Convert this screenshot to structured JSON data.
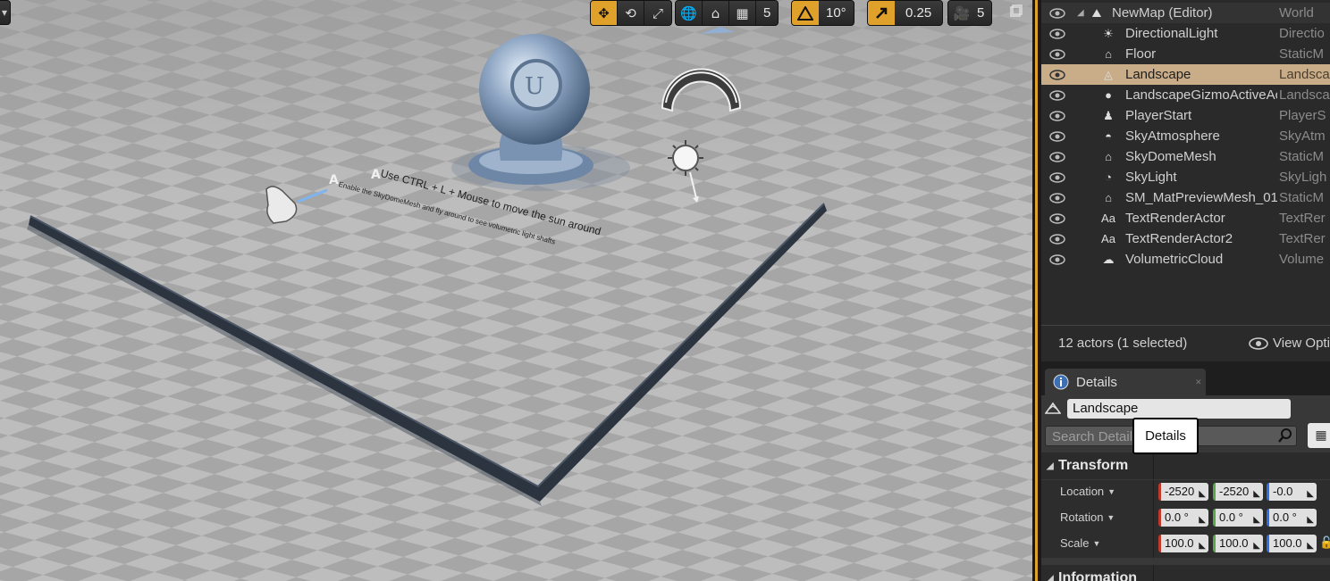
{
  "viewport": {
    "toolbar": {
      "grid_snap_value": "5",
      "rotation_snap_value": "10°",
      "scale_snap_value": "0.25",
      "camera_speed_value": "5"
    },
    "text_actor_1": "Use CTRL + L + Mouse to move the sun around",
    "text_actor_2": "Enable the SkyDomeMesh and fly around to see volumetric light shafts"
  },
  "outliner": {
    "rows": [
      {
        "name": "NewMap (Editor)",
        "type": "World",
        "icon": "map-icon"
      },
      {
        "name": "DirectionalLight",
        "type": "Directio",
        "icon": "directional-light-icon"
      },
      {
        "name": "Floor",
        "type": "StaticM",
        "icon": "static-mesh-icon"
      },
      {
        "name": "Landscape",
        "type": "Landsca",
        "icon": "landscape-icon"
      },
      {
        "name": "LandscapeGizmoActiveAc",
        "type": "Landsca",
        "icon": "sphere-icon"
      },
      {
        "name": "PlayerStart",
        "type": "PlayerS",
        "icon": "player-start-icon"
      },
      {
        "name": "SkyAtmosphere",
        "type": "SkyAtm",
        "icon": "sky-atmosphere-icon"
      },
      {
        "name": "SkyDomeMesh",
        "type": "StaticM",
        "icon": "static-mesh-icon"
      },
      {
        "name": "SkyLight",
        "type": "SkyLigh",
        "icon": "sky-light-icon"
      },
      {
        "name": "SM_MatPreviewMesh_01",
        "type": "StaticM",
        "icon": "static-mesh-icon"
      },
      {
        "name": "TextRenderActor",
        "type": "TextRer",
        "icon": "text-render-icon"
      },
      {
        "name": "TextRenderActor2",
        "type": "TextRer",
        "icon": "text-render-icon"
      },
      {
        "name": "VolumetricCloud",
        "type": "Volume",
        "icon": "volumetric-cloud-icon"
      }
    ],
    "selected_index": 3,
    "footer_count": "12 actors (1 selected)",
    "view_options_label": "View Opti"
  },
  "details": {
    "tab_label": "Details",
    "actor_name": "Landscape",
    "search_placeholder": "Search Detail",
    "tooltip": "Details",
    "transform_header": "Transform",
    "information_header": "Information",
    "location_label": "Location",
    "rotation_label": "Rotation",
    "scale_label": "Scale",
    "location": [
      "-2520",
      "-2520",
      "-0.0"
    ],
    "rotation": [
      "0.0 °",
      "0.0 °",
      "0.0 °"
    ],
    "scale": [
      "100.0",
      "100.0",
      "100.0"
    ]
  },
  "colors": {
    "accent": "#e0a12a",
    "selection": "#c9ad89",
    "x_axis": "#c0392b",
    "y_axis": "#5aa64a",
    "z_axis": "#2f6fe0"
  }
}
